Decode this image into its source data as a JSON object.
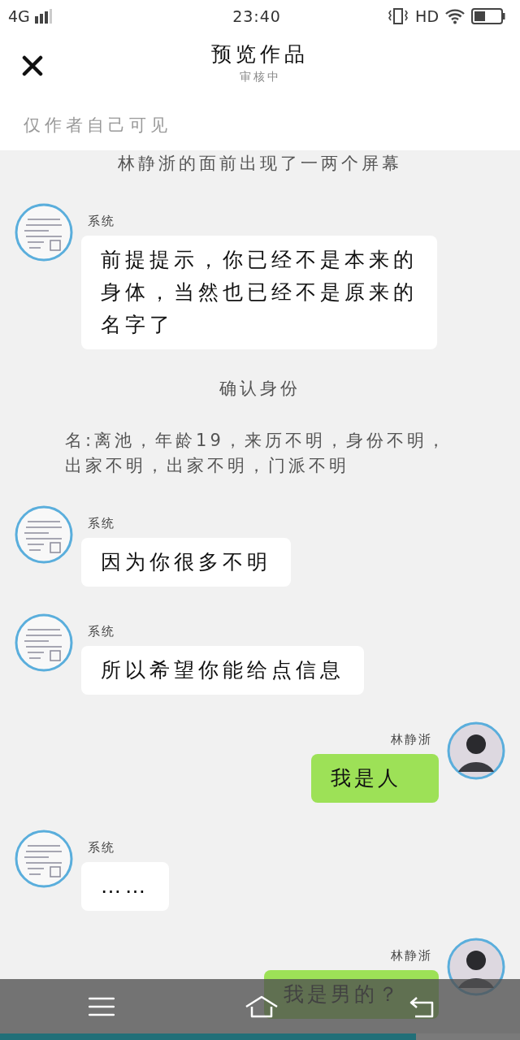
{
  "status_bar": {
    "network": "4G",
    "time": "23:40",
    "hd": "HD"
  },
  "header": {
    "title": "预览作品",
    "subtitle": "审核中",
    "visibility_note": "仅作者自己可见"
  },
  "messages": [
    {
      "kind": "narration",
      "text": "林静浙的面前出现了一两个屏幕"
    },
    {
      "kind": "incoming",
      "sender": "系统",
      "text": "前提提示，你已经不是本来的身体，当然也已经不是原来的名字了"
    },
    {
      "kind": "narration",
      "text": "确认身份"
    },
    {
      "kind": "narration",
      "text": "名:离池，年龄19，来历不明，身份不明，出家不明，出家不明，门派不明"
    },
    {
      "kind": "incoming",
      "sender": "系统",
      "text": "因为你很多不明"
    },
    {
      "kind": "incoming",
      "sender": "系统",
      "text": "所以希望你能给点信息"
    },
    {
      "kind": "outgoing",
      "sender": "林静浙",
      "text": "我是人"
    },
    {
      "kind": "incoming",
      "sender": "系统",
      "text": "……"
    },
    {
      "kind": "outgoing",
      "sender": "林静浙",
      "text": "我是男的？"
    }
  ],
  "reading_progress": {
    "level": 0.8
  }
}
